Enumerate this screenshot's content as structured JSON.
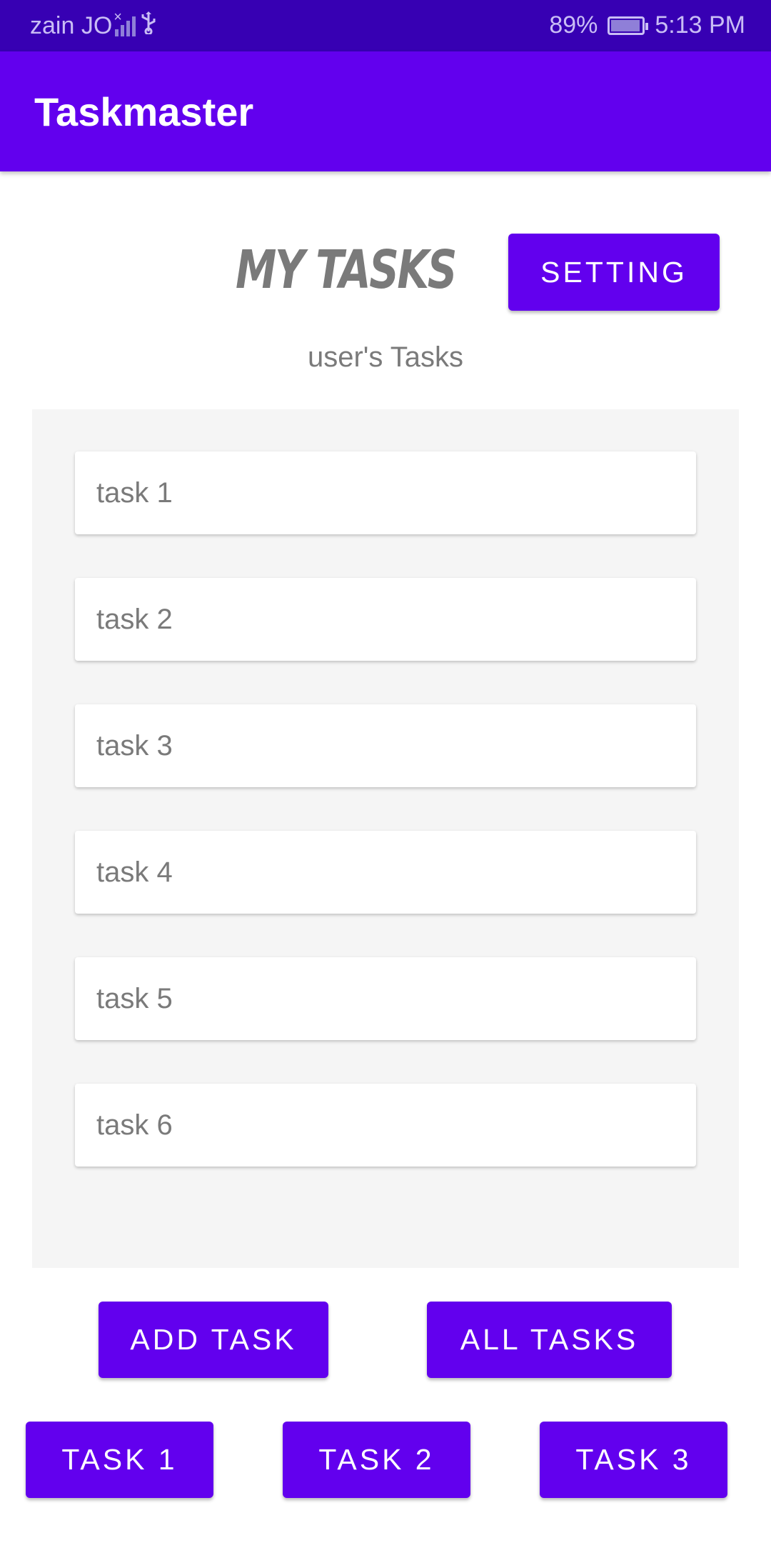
{
  "status_bar": {
    "carrier": "zain JO",
    "battery": "89%",
    "time": "5:13 PM"
  },
  "app_bar": {
    "title": "Taskmaster"
  },
  "header": {
    "heading": "MY TASKS",
    "setting_label": "SETTING",
    "subtitle": "user's Tasks"
  },
  "tasks": [
    {
      "label": "task 1"
    },
    {
      "label": "task 2"
    },
    {
      "label": "task 3"
    },
    {
      "label": "task 4"
    },
    {
      "label": "task 5"
    },
    {
      "label": "task 6"
    }
  ],
  "actions": {
    "add_task": "ADD TASK",
    "all_tasks": "ALL TASKS",
    "task1": "TASK 1",
    "task2": "TASK 2",
    "task3": "TASK 3"
  },
  "colors": {
    "status_bar": "#3700b3",
    "primary": "#6200ee",
    "panel": "#f5f5f5",
    "text_gray": "#7a7a7a"
  },
  "icons": [
    "signal-icon",
    "usb-icon",
    "battery-icon"
  ]
}
